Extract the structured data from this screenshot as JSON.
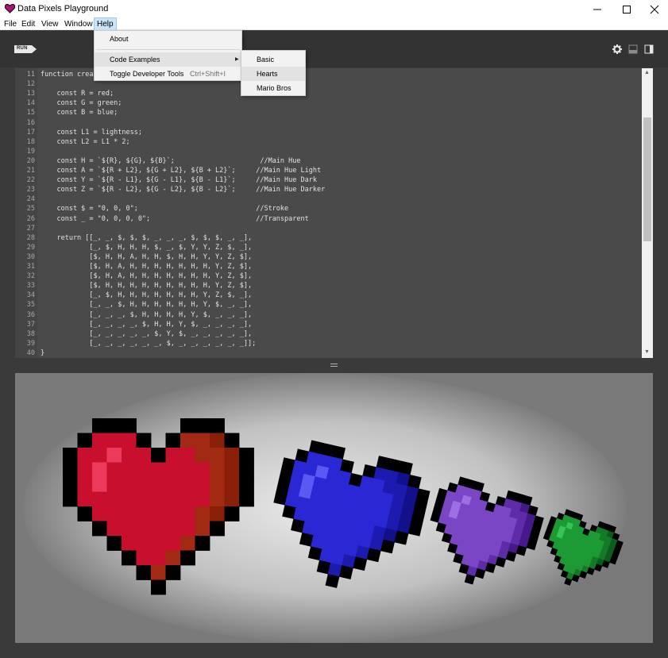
{
  "window": {
    "title": "Data Pixels Playground",
    "app_icon": "heart-icon",
    "controls": [
      "minimize-icon",
      "maximize-icon",
      "close-icon"
    ]
  },
  "menubar": {
    "items": [
      "File",
      "Edit",
      "View",
      "Window",
      "Help"
    ],
    "active": "Help"
  },
  "toolbar": {
    "run_label": "RUN",
    "icons": [
      "gear-icon",
      "layout-split-horizontal-icon",
      "layout-split-vertical-icon"
    ]
  },
  "help_menu": {
    "items": [
      {
        "label": "About",
        "shortcut": ""
      },
      {
        "label": "Code Examples",
        "shortcut": "",
        "submenu": true
      },
      {
        "label": "Toggle Developer Tools",
        "shortcut": "Ctrl+Shift+I"
      }
    ]
  },
  "code_examples_menu": {
    "items": [
      "Basic",
      "Hearts",
      "Mario Bros"
    ],
    "hovered": "Hearts"
  },
  "editor": {
    "line_numbers": [
      "11",
      "12",
      "13",
      "14",
      "15",
      "16",
      "17",
      "18",
      "19",
      "20",
      "21",
      "22",
      "23",
      "24",
      "25",
      "26",
      "27",
      "28",
      "29",
      "30",
      "31",
      "32",
      "33",
      "34",
      "35",
      "36",
      "37",
      "38",
      "39",
      "40"
    ],
    "lines": [
      "function crea                                    ) {",
      "",
      "    const R = red;",
      "    const G = green;",
      "    const B = blue;",
      "",
      "    const L1 = lightness;",
      "    const L2 = L1 * 2;",
      "",
      "    const H = `${R}, ${G}, ${B}`;                     //Main Hue",
      "    const A = `${R + L2}, ${G + L2}, ${B + L2}`;     //Main Hue Light",
      "    const Y = `${R - L1}, ${G - L1}, ${B - L1}`;     //Main Hue Dark",
      "    const Z = `${R - L2}, ${G - L2}, ${B - L2}`;     //Main Hue Darker",
      "",
      "    const $ = \"0, 0, 0\";                             //Stroke",
      "    const _ = \"0, 0, 0, 0\";                          //Transparent",
      "",
      "    return [[_, _, $, $, $, _, _, _, $, $, $, _, _],",
      "            [_, $, H, H, H, $, _, $, Y, Y, Z, $, _],",
      "            [$, H, H, A, H, H, $, H, H, Y, Y, Z, $],",
      "            [$, H, A, H, H, H, H, H, H, H, Y, Z, $],",
      "            [$, H, A, H, H, H, H, H, H, H, Y, Z, $],",
      "            [$, H, H, H, H, H, H, H, H, H, Y, Z, $],",
      "            [_, $, H, H, H, H, H, H, H, Y, Z, $, _],",
      "            [_, _, $, H, H, H, H, H, H, Y, $, _, _],",
      "            [_, _, _, $, H, H, H, H, Y, $, _, _, _],",
      "            [_, _, _, _, $, H, H, Y, $, _, _, _, _],",
      "            [_, _, _, _, _, $, Y, $, _, _, _, _, _],",
      "            [_, _, _, _, _, _, $, _, _, _, _, _, _]];",
      "}"
    ]
  },
  "hearts": {
    "pattern": [
      "__$$$___$$$__",
      "_$HHH$_$YYZ$_",
      "$HHAHH$HHYYZ$",
      "$HAHHHHHHHYZ$",
      "$HAHHHHHHHYZ$",
      "$HHHHHHHHHYZ$",
      "_$HHHHHHHYZ$_",
      "__$HHHHHHY$__",
      "___$HHHHY$___",
      "____$HHY$____",
      "_____$Y$_____",
      "______$______"
    ],
    "items": [
      {
        "name": "red",
        "colors": {
          "H": "#c8102e",
          "A": "#ec3a5c",
          "Y": "#a22a12",
          "Z": "#8a1f08",
          "S": "#000000"
        }
      },
      {
        "name": "blue",
        "colors": {
          "H": "#2a28d4",
          "A": "#5b59f5",
          "Y": "#1d1ab0",
          "Z": "#12108a",
          "S": "#000000"
        }
      },
      {
        "name": "purple",
        "colors": {
          "H": "#7a46c6",
          "A": "#9d6fe0",
          "Y": "#5e2ca8",
          "Z": "#45198a",
          "S": "#000000"
        }
      },
      {
        "name": "green",
        "colors": {
          "H": "#1c9a34",
          "A": "#38c452",
          "Y": "#157a28",
          "Z": "#0d5c1c",
          "S": "#000000"
        }
      }
    ]
  },
  "colors": {
    "title_bg": "#ffffff",
    "toolbar_bg": "#333333",
    "editor_bg": "#4a4a4a",
    "canvas_bg": "#7a7a7a"
  }
}
